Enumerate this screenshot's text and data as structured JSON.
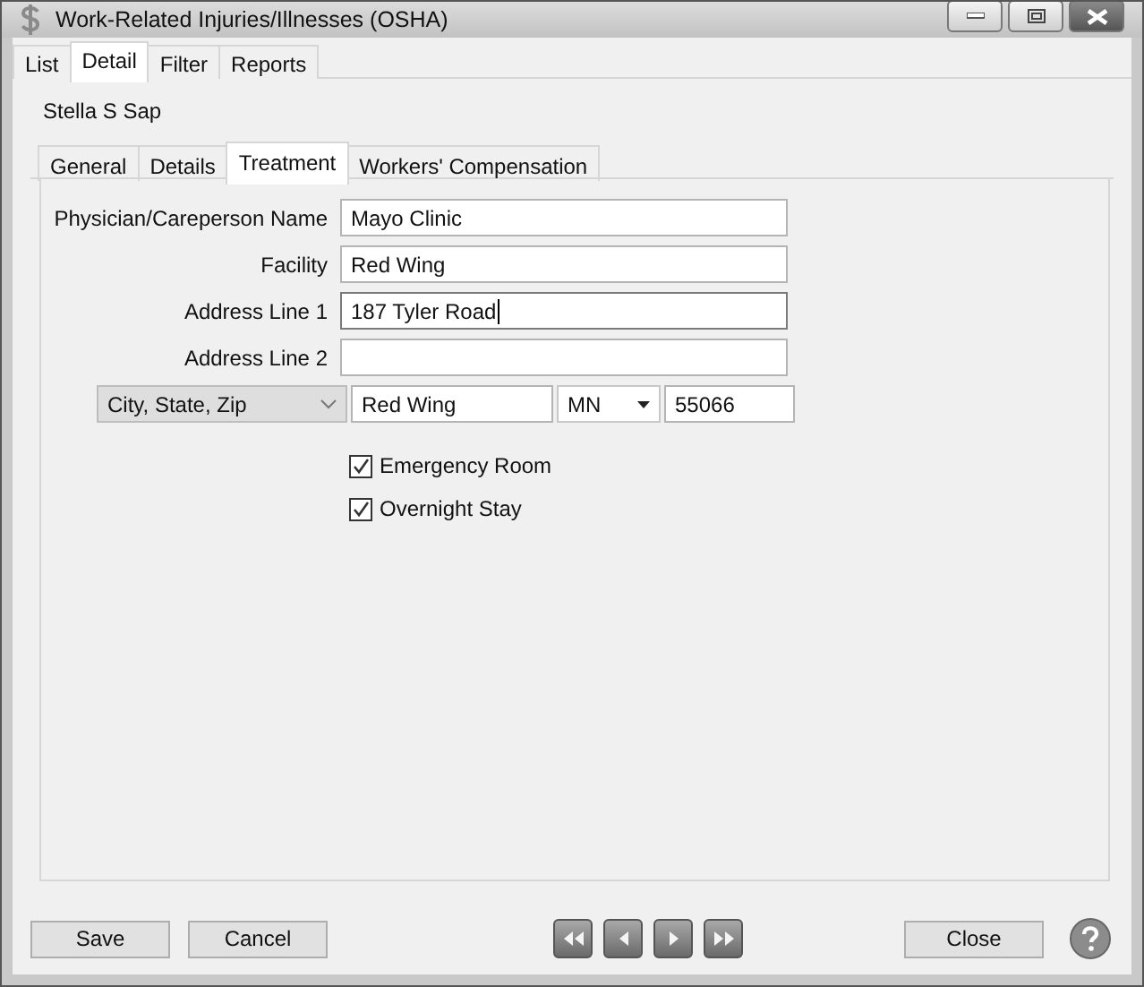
{
  "window": {
    "title": "Work-Related Injuries/Illnesses (OSHA)"
  },
  "tabs": [
    {
      "label": "List",
      "selected": false
    },
    {
      "label": "Detail",
      "selected": true
    },
    {
      "label": "Filter",
      "selected": false
    },
    {
      "label": "Reports",
      "selected": false
    }
  ],
  "employee_name": "Stella S Sap",
  "subtabs": [
    {
      "label": "General",
      "selected": false
    },
    {
      "label": "Details",
      "selected": false
    },
    {
      "label": "Treatment",
      "selected": true
    },
    {
      "label": "Workers' Compensation",
      "selected": false
    }
  ],
  "fields": [
    {
      "label": "Physician/Careperson Name",
      "value": "Mayo Clinic",
      "focused": false
    },
    {
      "label": "Facility",
      "value": "Red Wing",
      "focused": false
    },
    {
      "label": "Address Line 1",
      "value": "187 Tyler Road",
      "focused": true
    },
    {
      "label": "Address Line 2",
      "focused": false
    }
  ],
  "address_row": {
    "selector": "City, State, Zip",
    "city": "Red Wing",
    "state": "MN",
    "zip": "55066"
  },
  "checkboxes": [
    {
      "label": "Emergency Room",
      "checked": true
    },
    {
      "label": "Overnight Stay",
      "checked": true
    }
  ],
  "buttons": {
    "save": "Save",
    "cancel": "Cancel",
    "close": "Close"
  }
}
